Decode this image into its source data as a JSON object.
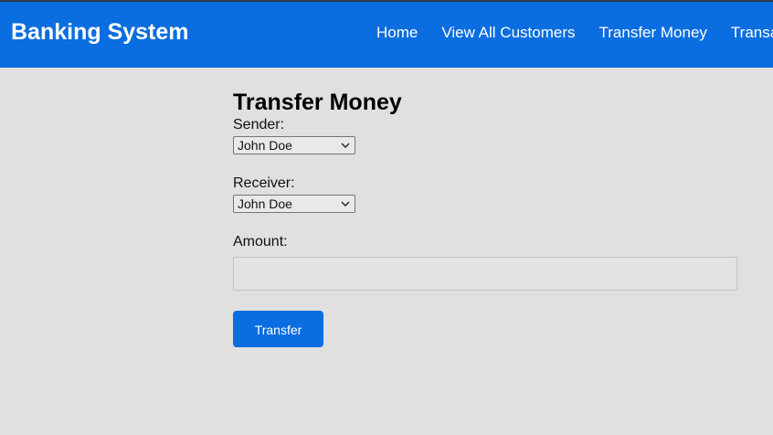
{
  "header": {
    "brand": "Banking System",
    "nav": [
      "Home",
      "View All Customers",
      "Transfer Money",
      "Transaction History"
    ]
  },
  "form": {
    "title": "Transfer Money",
    "sender_label": "Sender:",
    "sender_value": "John Doe",
    "receiver_label": "Receiver:",
    "receiver_value": "John Doe",
    "amount_label": "Amount:",
    "amount_value": "",
    "submit_label": "Transfer"
  },
  "colors": {
    "primary": "#0a6de0",
    "background": "#e0e0e0"
  },
  "icons": {
    "select_arrow": "chevron-down-icon"
  }
}
